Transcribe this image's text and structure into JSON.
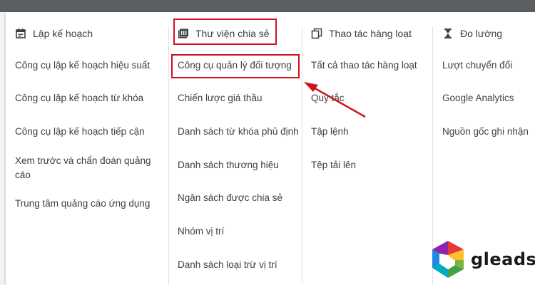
{
  "columns": [
    {
      "title": "Lập kế hoạch",
      "icon": "calendar-icon",
      "items": [
        "Công cụ lập kế hoạch hiệu suất",
        "Công cụ lập kế hoạch từ khóa",
        "Công cụ lập kế hoạch tiếp cận",
        "Xem trước và chẩn đoán quảng cáo",
        "Trung tâm quảng cáo ứng dụng"
      ]
    },
    {
      "title": "Thư viện chia sẻ",
      "icon": "library-icon",
      "items": [
        "Công cụ quản lý đối tượng",
        "Chiến lược giá thầu",
        "Danh sách từ khóa phủ định",
        "Danh sách thương hiệu",
        "Ngân sách được chia sẻ",
        "Nhóm vị trí",
        "Danh sách loại trừ vị trí"
      ]
    },
    {
      "title": "Thao tác hàng loạt",
      "icon": "copy-icon",
      "items": [
        "Tất cả thao tác hàng loạt",
        "Quy tắc",
        "Tập lệnh",
        "Tệp tải lên"
      ]
    },
    {
      "title": "Đo lường",
      "icon": "hourglass-icon",
      "items": [
        "Lượt chuyển đổi",
        "Google Analytics",
        "Nguồn gốc ghi nhận"
      ]
    }
  ],
  "logo": {
    "text": "gleads"
  },
  "colors": {
    "highlight": "#d0121b",
    "text": "#3c4043",
    "divider": "#e3e3e3"
  }
}
